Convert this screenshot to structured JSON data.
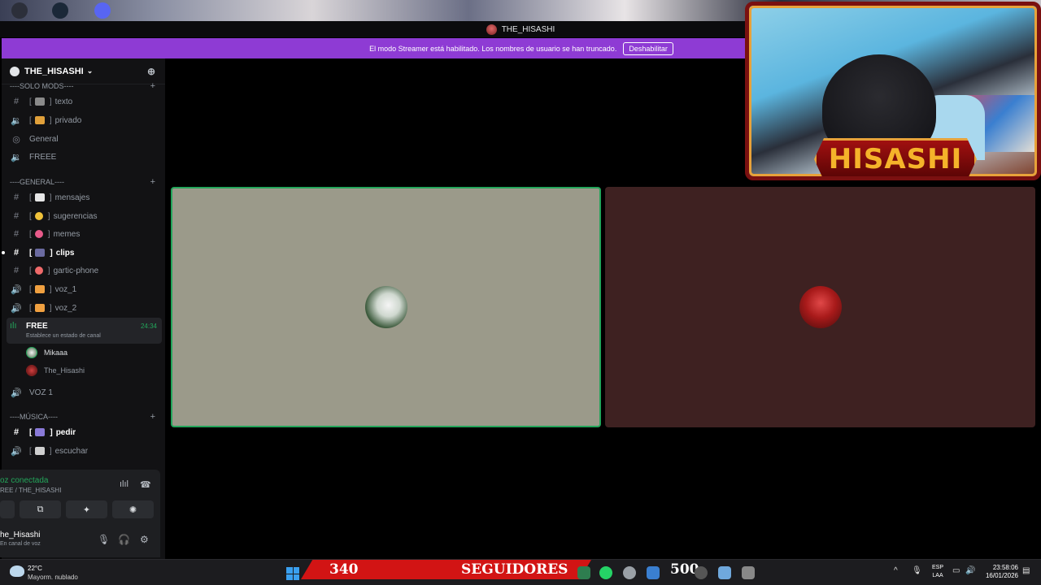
{
  "window": {
    "title": "THE_HISASHI"
  },
  "banner": {
    "text": "El modo Streamer está habilitado. Los nombres de usuario se han truncado.",
    "button": "Deshabilitar"
  },
  "server": {
    "name": "THE_HISASHI",
    "chevron": "⌄"
  },
  "categories": {
    "solo_mods": "----SOLO MODS----",
    "general": "----GENERAL----",
    "musica": "----MÚSICA----"
  },
  "channels": {
    "texto": "texto",
    "privado": "privado",
    "general_voice": "General",
    "freee": "FREEE",
    "mensajes": "mensajes",
    "sugerencias": "sugerencias",
    "memes": "memes",
    "clips": "clips",
    "gartic": "gartic-phone",
    "voz_1": "voz_1",
    "voz_2": "voz_2",
    "voz_1_upper": "VOZ 1",
    "pedir": "pedir",
    "escuchar": "escuchar"
  },
  "active_voice": {
    "name": "FREE",
    "status": "Establece un estado de canal",
    "timer": "24:34",
    "members": [
      "Mikaaa",
      "The_Hisashi"
    ]
  },
  "voice_panel": {
    "title": "oz conectada",
    "subtitle": "REE / THE_HISASHI"
  },
  "user_panel": {
    "name": "he_Hisashi",
    "status": "En canal de voz"
  },
  "webcam": {
    "label": "HISASHI"
  },
  "taskbar": {
    "weather_temp": "22°C",
    "weather_desc": "Mayorm. nublado",
    "followers_count": "340",
    "followers_label": "SEGUIDORES",
    "followers_goal": "500",
    "lang_1": "ESP",
    "lang_2": "LAA",
    "time": "23:58:06",
    "date": "16/01/2026"
  },
  "colors": {
    "banner": "#8e3bd4",
    "accent_green": "#23a55a",
    "follower_bar": "#d21414",
    "cam_border": "#7a1010",
    "cam_gold": "#e8a23a"
  },
  "icons": {
    "text_channel": "#",
    "voice_channel": "🔊",
    "plus": "+"
  }
}
